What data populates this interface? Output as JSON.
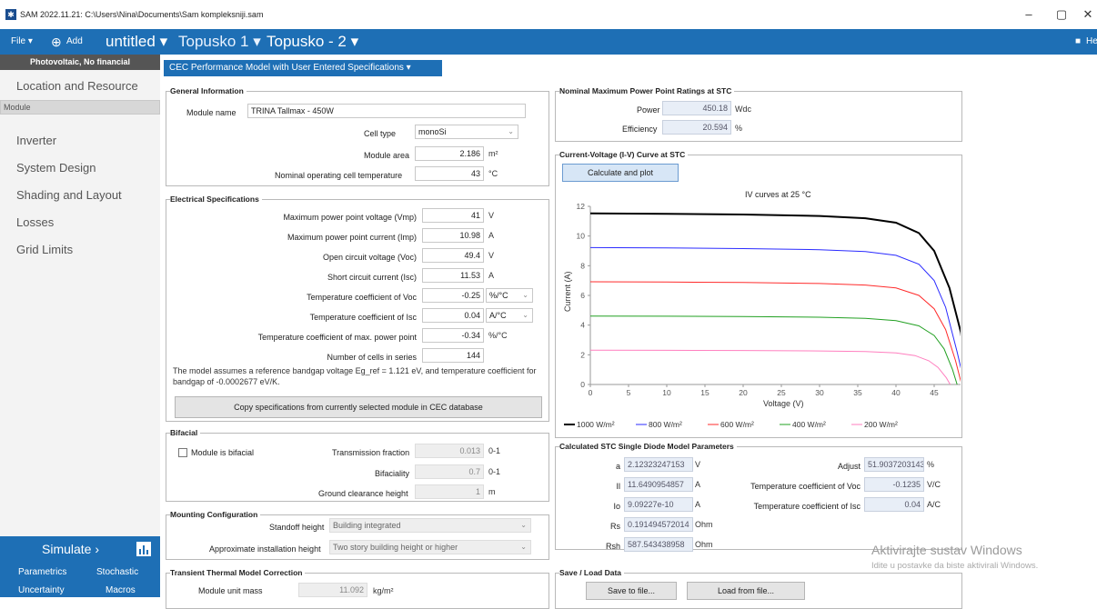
{
  "window": {
    "title": "SAM 2022.11.21: C:\\Users\\Nina\\Documents\\Sam kompleksniji.sam",
    "app_icon": "sam-app-icon",
    "min": "–",
    "max": "▢",
    "close": "✕"
  },
  "menubar": {
    "file": "File",
    "file_caret": "▾",
    "add": "Add",
    "add_icon": "⊕",
    "cases": [
      {
        "label": "untitled",
        "caret": "▾"
      },
      {
        "label": "Topusko 1",
        "caret": "▾"
      },
      {
        "label": "Topusko - 2",
        "caret": "▾"
      }
    ],
    "help": "Hel",
    "help_icon": "■"
  },
  "sidebar": {
    "header": "Photovoltaic, No financial",
    "items": [
      "Location and Resource",
      "Module",
      "Inverter",
      "System Design",
      "Shading and Layout",
      "Losses",
      "Grid Limits"
    ],
    "selected": "Module",
    "simulate": "Simulate",
    "simulate_arrow": "›",
    "bottom": [
      "Parametrics",
      "Stochastic",
      "Uncertainty",
      "Macros"
    ]
  },
  "model_select": "CEC Performance Model with User Entered Specifications",
  "general": {
    "title": "General Information",
    "module_name_label": "Module name",
    "module_name": "TRINA Tallmax - 450W",
    "cell_type_label": "Cell type",
    "cell_type": "monoSi",
    "module_area_label": "Module area",
    "module_area": "2.186",
    "module_area_unit": "m²",
    "noct_label": "Nominal operating cell temperature",
    "noct": "43",
    "noct_unit": "°C"
  },
  "electrical": {
    "title": "Electrical Specifications",
    "rows": [
      {
        "label": "Maximum power point voltage (Vmp)",
        "value": "41",
        "unit": "V"
      },
      {
        "label": "Maximum power point current (Imp)",
        "value": "10.98",
        "unit": "A"
      },
      {
        "label": "Open circuit voltage (Voc)",
        "value": "49.4",
        "unit": "V"
      },
      {
        "label": "Short circuit current (Isc)",
        "value": "11.53",
        "unit": "A"
      },
      {
        "label": "Temperature coefficient of Voc",
        "value": "-0.25",
        "unit": "%/°C"
      },
      {
        "label": "Temperature coefficient of Isc",
        "value": "0.04",
        "unit": "A/°C"
      },
      {
        "label": "Temperature coefficient of max. power point",
        "value": "-0.34",
        "unit": "%/°C"
      },
      {
        "label": "Number of cells in series",
        "value": "144",
        "unit": ""
      }
    ],
    "note": "The model assumes a reference bandgap voltage Eg_ref = 1.121 eV, and temperature coefficient for bandgap of -0.0002677 eV/K.",
    "copy_button": "Copy specifications from currently selected module in CEC database"
  },
  "bifacial": {
    "title": "Bifacial",
    "checkbox": "Module is bifacial",
    "transmission_label": "Transmission fraction",
    "transmission": "0.013",
    "transmission_unit": "0-1",
    "bifaciality_label": "Bifaciality",
    "bifaciality": "0.7",
    "bifaciality_unit": "0-1",
    "ground_label": "Ground clearance height",
    "ground": "1",
    "ground_unit": "m"
  },
  "mounting": {
    "title": "Mounting Configuration",
    "standoff_label": "Standoff height",
    "standoff": "Building integrated",
    "install_label": "Approximate installation height",
    "install": "Two story building height or higher"
  },
  "thermal": {
    "title": "Transient Thermal Model Correction",
    "mass_label": "Module unit mass",
    "mass": "11.092",
    "mass_unit": "kg/m²"
  },
  "nominal": {
    "title": "Nominal Maximum Power Point Ratings at STC",
    "power_label": "Power",
    "power": "450.18",
    "power_unit": "Wdc",
    "eff_label": "Efficiency",
    "eff": "20.594",
    "eff_unit": "%"
  },
  "iv": {
    "title": "Current-Voltage (I-V) Curve at STC",
    "button": "Calculate and plot"
  },
  "stc": {
    "title": "Calculated STC Single Diode Model Parameters",
    "left": [
      {
        "label": "a",
        "value": "2.12323247153",
        "unit": "V"
      },
      {
        "label": "Il",
        "value": "11.6490954857",
        "unit": "A"
      },
      {
        "label": "Io",
        "value": "9.09227e-10",
        "unit": "A"
      },
      {
        "label": "Rs",
        "value": "0.191494572014",
        "unit": "Ohm"
      },
      {
        "label": "Rsh",
        "value": "587.543438958",
        "unit": "Ohm"
      }
    ],
    "right": [
      {
        "label": "Adjust",
        "value": "51.9037203143",
        "unit": "%"
      },
      {
        "label": "Temperature coefficient of Voc",
        "value": "-0.1235",
        "unit": "V/C"
      },
      {
        "label": "Temperature coefficient of Isc",
        "value": "0.04",
        "unit": "A/C"
      }
    ]
  },
  "saveload": {
    "title": "Save / Load Data",
    "save": "Save to file...",
    "load": "Load from file..."
  },
  "watermark": {
    "line1": "Aktivirajte sustav Windows",
    "line2": "Idite u postavke da biste aktivirali Windows."
  },
  "chart_data": {
    "type": "line",
    "title": "IV curves at 25 °C",
    "xlabel": "Voltage (V)",
    "ylabel": "Current (A)",
    "xlim": [
      0,
      50
    ],
    "ylim": [
      0,
      12
    ],
    "xticks": [
      0,
      5,
      10,
      15,
      20,
      25,
      30,
      35,
      40,
      45,
      50
    ],
    "yticks": [
      0,
      2,
      4,
      6,
      8,
      10,
      12
    ],
    "series": [
      {
        "name": "1000 W/m²",
        "color": "#000000",
        "x": [
          0,
          10,
          20,
          30,
          36,
          40,
          43,
          45,
          47,
          48.5,
          49.4
        ],
        "y": [
          11.53,
          11.5,
          11.45,
          11.35,
          11.2,
          10.9,
          10.2,
          9.0,
          6.5,
          3.5,
          0
        ]
      },
      {
        "name": "800 W/m²",
        "color": "#2b2bff",
        "x": [
          0,
          10,
          20,
          30,
          36,
          40,
          43,
          45,
          46.5,
          48,
          49.0
        ],
        "y": [
          9.22,
          9.2,
          9.15,
          9.08,
          8.95,
          8.7,
          8.1,
          7.0,
          5.2,
          2.2,
          0
        ]
      },
      {
        "name": "600 W/m²",
        "color": "#ff2b2b",
        "x": [
          0,
          10,
          20,
          30,
          36,
          40,
          43,
          45,
          46.5,
          47.8,
          48.6
        ],
        "y": [
          6.92,
          6.9,
          6.87,
          6.8,
          6.7,
          6.5,
          6.0,
          5.1,
          3.7,
          1.6,
          0
        ]
      },
      {
        "name": "400 W/m²",
        "color": "#22a022",
        "x": [
          0,
          10,
          20,
          30,
          36,
          40,
          43,
          45,
          46.3,
          47.4,
          48.0
        ],
        "y": [
          4.61,
          4.6,
          4.58,
          4.53,
          4.46,
          4.3,
          3.95,
          3.3,
          2.4,
          1.0,
          0
        ]
      },
      {
        "name": "200 W/m²",
        "color": "#ff7fbf",
        "x": [
          0,
          10,
          20,
          30,
          36,
          40,
          42.5,
          44.3,
          45.5,
          46.6,
          47.1
        ],
        "y": [
          2.31,
          2.3,
          2.29,
          2.26,
          2.22,
          2.13,
          1.95,
          1.6,
          1.15,
          0.45,
          0
        ]
      }
    ]
  }
}
